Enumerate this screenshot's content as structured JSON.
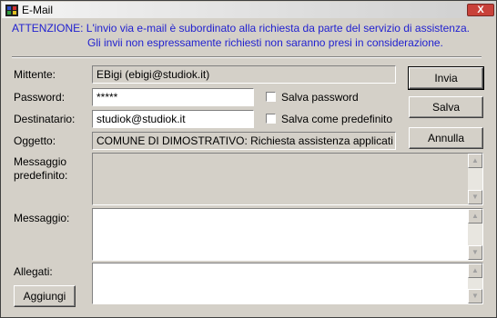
{
  "window": {
    "title": "E-Mail",
    "close_label": "X"
  },
  "notice": {
    "line1": "ATTENZIONE: L'invio via e-mail è subordinato alla richiesta da parte del servizio di assistenza.",
    "line2": "Gli invii non espressamente richiesti non saranno presi in considerazione."
  },
  "form": {
    "mittente_label": "Mittente:",
    "mittente_value": "EBigi (ebigi@studiok.it)",
    "password_label": "Password:",
    "password_value": "*****",
    "destinatario_label": "Destinatario:",
    "destinatario_value": "studiok@studiok.it",
    "oggetto_label": "Oggetto:",
    "oggetto_value": "COMUNE DI DIMOSTRATIVO: Richiesta assistenza applicati",
    "messaggio_predefinito_label_1": "Messaggio",
    "messaggio_predefinito_label_2": "predefinito:",
    "messaggio_label": "Messaggio:",
    "allegati_label": "Allegati:"
  },
  "checkboxes": {
    "salva_password": "Salva password",
    "salva_predefinito": "Salva come predefinito"
  },
  "buttons": {
    "invia": "Invia",
    "salva": "Salva",
    "annulla": "Annulla",
    "aggiungi": "Aggiungi"
  },
  "scroll_arrows": {
    "up": "▲",
    "down": "▼"
  }
}
